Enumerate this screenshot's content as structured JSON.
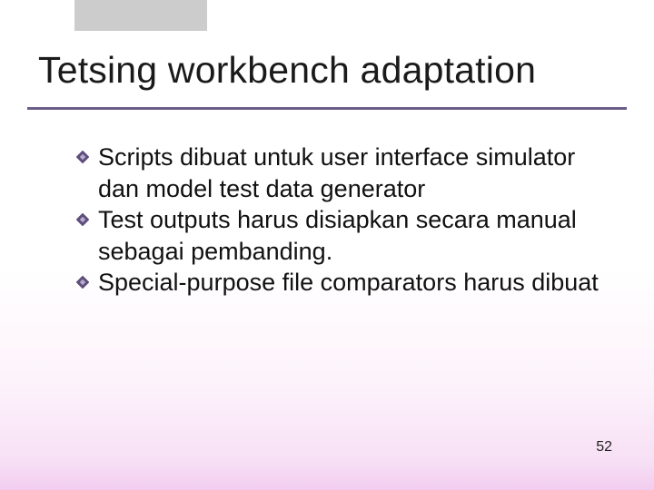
{
  "title": "Tetsing workbench adaptation",
  "bullets": {
    "items": [
      {
        "text": "Scripts dibuat untuk user interface simulator dan model test data generator"
      },
      {
        "text": "Test outputs harus disiapkan secara manual sebagai pembanding."
      },
      {
        "text": "Special-purpose file comparators harus dibuat"
      }
    ]
  },
  "page_number": "52",
  "accent_color": "#6b5d87"
}
